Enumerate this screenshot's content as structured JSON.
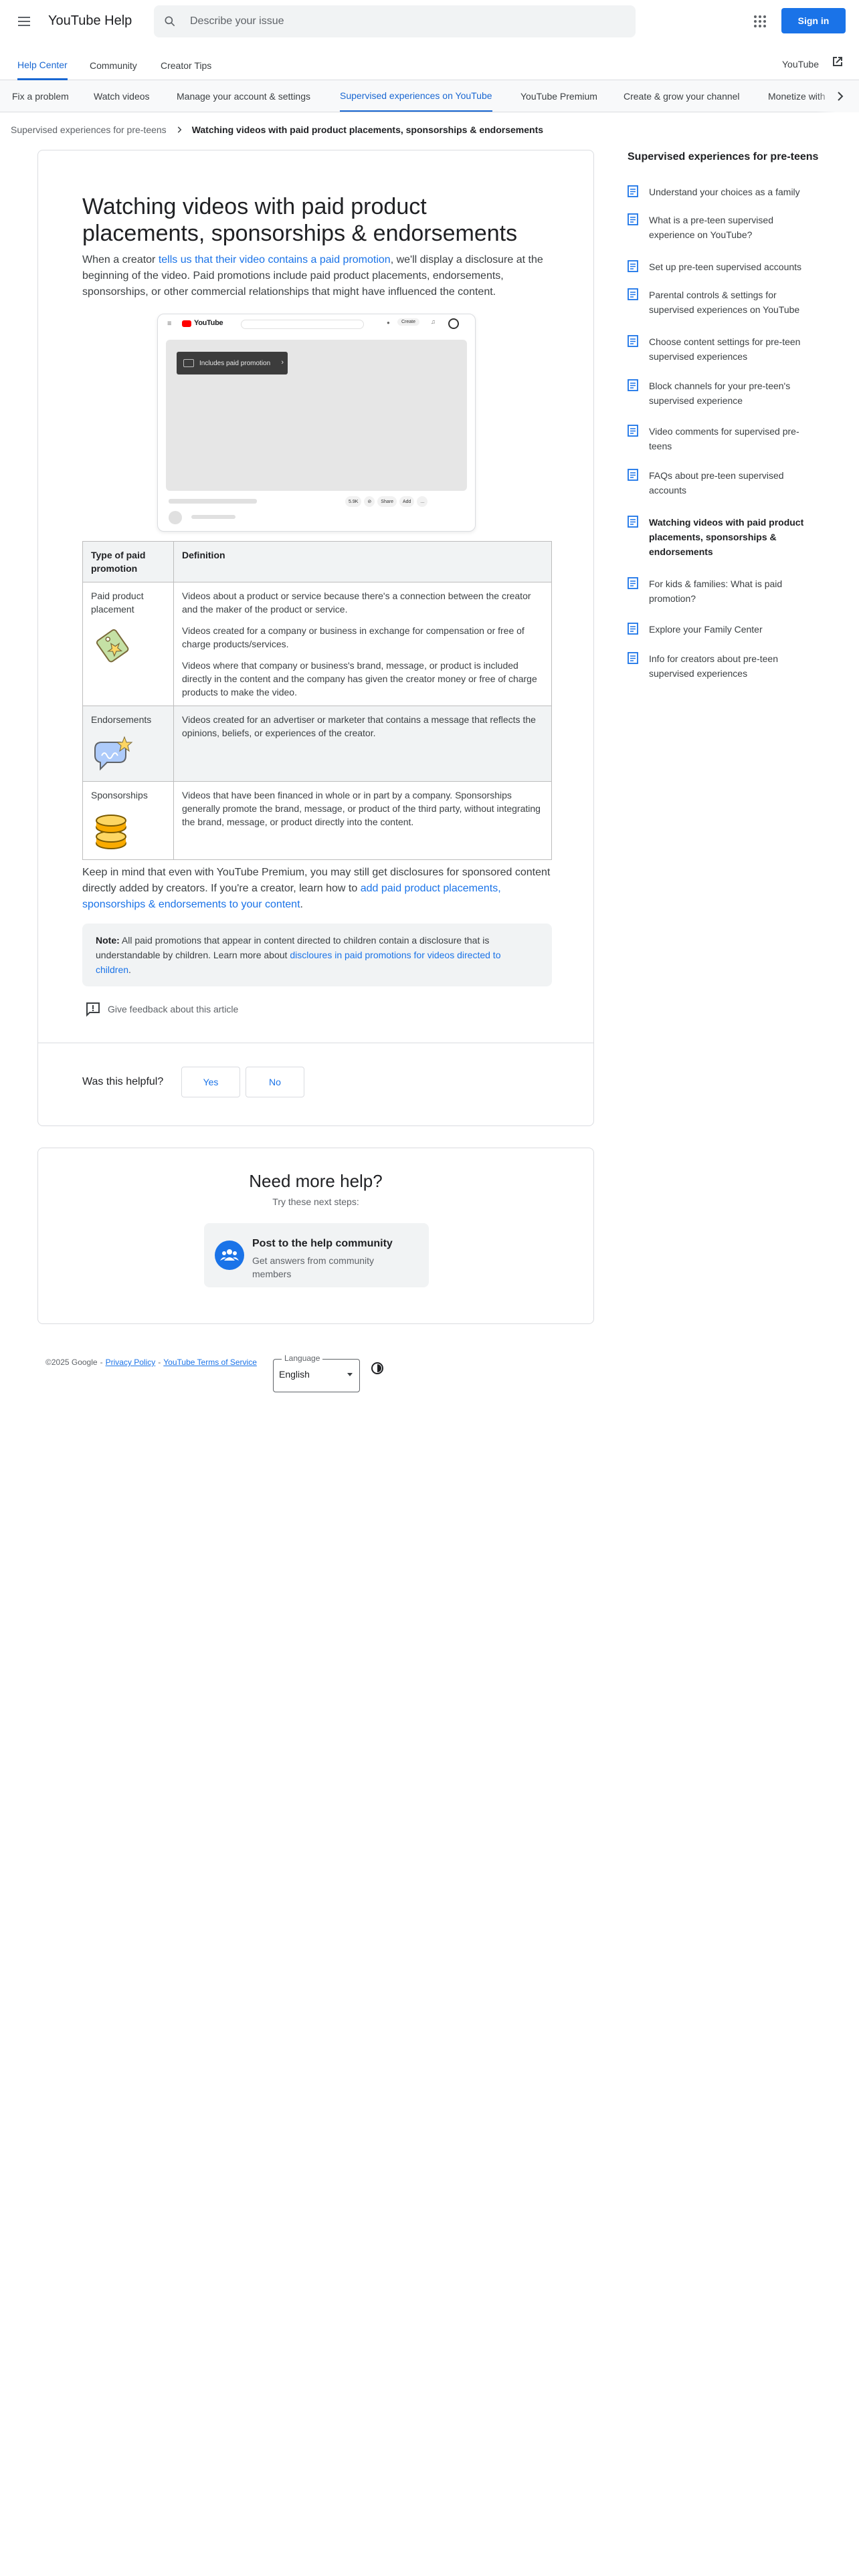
{
  "header": {
    "product_title": "YouTube Help",
    "search_placeholder": "Describe your issue",
    "sign_in": "Sign in"
  },
  "subnav": {
    "tabs": [
      "Help Center",
      "Community",
      "Creator Tips"
    ],
    "youtube_link": "YouTube"
  },
  "category_tabs": [
    "Fix a problem",
    "Watch videos",
    "Manage your account & settings",
    "Supervised experiences on YouTube",
    "YouTube Premium",
    "Create & grow your channel",
    "Monetize with"
  ],
  "breadcrumb": {
    "parent": "Supervised experiences for pre-teens",
    "current": "Watching videos with paid product placements, sponsorships & endorsements"
  },
  "article": {
    "title": "Watching videos with paid product placements, sponsorships & endorsements",
    "intro_pre": "When a creator ",
    "intro_link": "tells us that their video contains a paid promotion",
    "intro_post": ", we'll display a disclosure at the beginning of the video. Paid promotions include paid product placements, endorsements, sponsorships, or other commercial relationships that might have influenced the content.",
    "mock": {
      "logo_text": "YouTube",
      "badge_text": "Includes paid promotion",
      "actions": [
        "5.9K",
        "",
        "Share",
        "Add",
        "..."
      ],
      "create_label": "Create"
    },
    "table": {
      "headers": [
        "Type of paid promotion",
        "Definition"
      ],
      "rows": [
        {
          "type": "Paid product placement",
          "definitions": [
            "Videos about a product or service because there's a connection between the creator and the maker of the product or service.",
            "Videos created for a company or business in exchange for compensation or free of charge products/services.",
            "Videos where that company or business's brand, message, or product is included directly in the content and the company has given the creator money or free of charge products to make the video."
          ]
        },
        {
          "type": "Endorsements",
          "definitions": [
            "Videos created for an advertiser or marketer that contains a message that reflects the opinions, beliefs, or experiences of the creator."
          ]
        },
        {
          "type": "Sponsorships",
          "definitions": [
            "Videos that have been financed in whole or in part by a company. Sponsorships generally promote the brand, message, or product of the third party, without integrating the brand, message, or product directly into the content."
          ]
        }
      ]
    },
    "keep_in_mind_pre": "Keep in mind that even with YouTube Premium, you may still get disclosures for sponsored content directly added by creators. If you're a creator, learn how to ",
    "keep_in_mind_link": "add paid product placements, sponsorships & endorsements to your content",
    "keep_in_mind_post": ".",
    "note_label": "Note:",
    "note_text": " All paid promotions that appear in content directed to children contain a disclosure that is understandable by children. Learn more about ",
    "note_link": "discloures in paid promotions for videos directed to children",
    "note_post": ".",
    "feedback": "Give feedback about this article",
    "helpful_question": "Was this helpful?",
    "yes": "Yes",
    "no": "No"
  },
  "need_help": {
    "title": "Need more help?",
    "subtitle": "Try these next steps:",
    "community_title": "Post to the help community",
    "community_desc": "Get answers from community members"
  },
  "footer": {
    "copyright": "©2025 Google",
    "sep": "-",
    "privacy": "Privacy Policy",
    "terms": "YouTube Terms of Service",
    "language_label": "Language",
    "language_value": "English"
  },
  "sidebar": {
    "title": "Supervised experiences for pre-teens",
    "items": [
      "Understand your choices as a family",
      "What is a pre-teen supervised experience on YouTube?",
      "Set up pre-teen supervised accounts",
      "Parental controls & settings for supervised experiences on YouTube",
      "Choose content settings for pre-teen supervised experiences",
      "Block channels for your pre-teen's supervised experience",
      "Video comments for supervised pre-teens",
      "FAQs about pre-teen supervised accounts",
      "Watching videos with paid product placements, sponsorships & endorsements",
      "For kids & families: What is paid promotion?",
      "Explore your Family Center",
      "Info for creators about pre-teen supervised experiences"
    ]
  },
  "colors": {
    "accent": "#1a73e8",
    "active_tab": "#1967d2"
  }
}
